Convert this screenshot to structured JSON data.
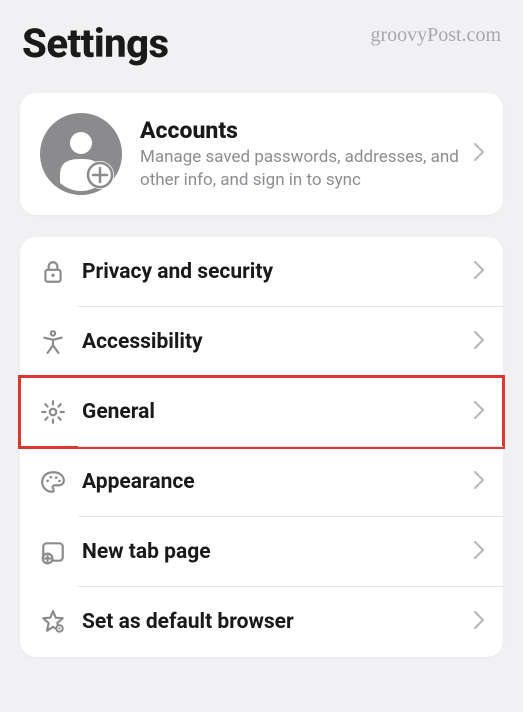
{
  "header": {
    "title": "Settings",
    "watermark": "groovyPost.com"
  },
  "accounts": {
    "title": "Accounts",
    "subtitle": "Manage saved passwords, addresses, and other info, and sign in to sync"
  },
  "menu": {
    "items": [
      {
        "label": "Privacy and security",
        "icon": "lock-icon",
        "highlighted": false
      },
      {
        "label": "Accessibility",
        "icon": "accessibility-icon",
        "highlighted": false
      },
      {
        "label": "General",
        "icon": "gear-icon",
        "highlighted": true
      },
      {
        "label": "Appearance",
        "icon": "palette-icon",
        "highlighted": false
      },
      {
        "label": "New tab page",
        "icon": "new-tab-icon",
        "highlighted": false
      },
      {
        "label": "Set as default browser",
        "icon": "star-gear-icon",
        "highlighted": false
      }
    ]
  }
}
